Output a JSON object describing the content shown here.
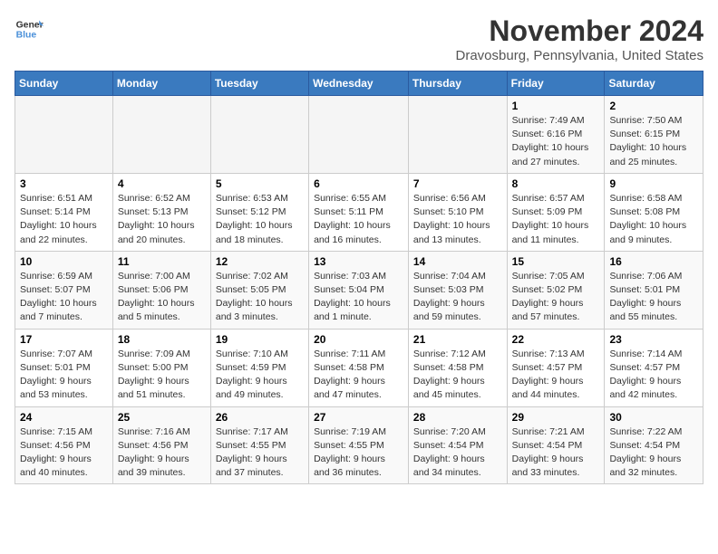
{
  "app": {
    "name_part1": "General",
    "name_part2": "Blue"
  },
  "header": {
    "month_year": "November 2024",
    "location": "Dravosburg, Pennsylvania, United States"
  },
  "weekdays": [
    "Sunday",
    "Monday",
    "Tuesday",
    "Wednesday",
    "Thursday",
    "Friday",
    "Saturday"
  ],
  "weeks": [
    [
      {
        "day": "",
        "info": ""
      },
      {
        "day": "",
        "info": ""
      },
      {
        "day": "",
        "info": ""
      },
      {
        "day": "",
        "info": ""
      },
      {
        "day": "",
        "info": ""
      },
      {
        "day": "1",
        "info": "Sunrise: 7:49 AM\nSunset: 6:16 PM\nDaylight: 10 hours and 27 minutes."
      },
      {
        "day": "2",
        "info": "Sunrise: 7:50 AM\nSunset: 6:15 PM\nDaylight: 10 hours and 25 minutes."
      }
    ],
    [
      {
        "day": "3",
        "info": "Sunrise: 6:51 AM\nSunset: 5:14 PM\nDaylight: 10 hours and 22 minutes."
      },
      {
        "day": "4",
        "info": "Sunrise: 6:52 AM\nSunset: 5:13 PM\nDaylight: 10 hours and 20 minutes."
      },
      {
        "day": "5",
        "info": "Sunrise: 6:53 AM\nSunset: 5:12 PM\nDaylight: 10 hours and 18 minutes."
      },
      {
        "day": "6",
        "info": "Sunrise: 6:55 AM\nSunset: 5:11 PM\nDaylight: 10 hours and 16 minutes."
      },
      {
        "day": "7",
        "info": "Sunrise: 6:56 AM\nSunset: 5:10 PM\nDaylight: 10 hours and 13 minutes."
      },
      {
        "day": "8",
        "info": "Sunrise: 6:57 AM\nSunset: 5:09 PM\nDaylight: 10 hours and 11 minutes."
      },
      {
        "day": "9",
        "info": "Sunrise: 6:58 AM\nSunset: 5:08 PM\nDaylight: 10 hours and 9 minutes."
      }
    ],
    [
      {
        "day": "10",
        "info": "Sunrise: 6:59 AM\nSunset: 5:07 PM\nDaylight: 10 hours and 7 minutes."
      },
      {
        "day": "11",
        "info": "Sunrise: 7:00 AM\nSunset: 5:06 PM\nDaylight: 10 hours and 5 minutes."
      },
      {
        "day": "12",
        "info": "Sunrise: 7:02 AM\nSunset: 5:05 PM\nDaylight: 10 hours and 3 minutes."
      },
      {
        "day": "13",
        "info": "Sunrise: 7:03 AM\nSunset: 5:04 PM\nDaylight: 10 hours and 1 minute."
      },
      {
        "day": "14",
        "info": "Sunrise: 7:04 AM\nSunset: 5:03 PM\nDaylight: 9 hours and 59 minutes."
      },
      {
        "day": "15",
        "info": "Sunrise: 7:05 AM\nSunset: 5:02 PM\nDaylight: 9 hours and 57 minutes."
      },
      {
        "day": "16",
        "info": "Sunrise: 7:06 AM\nSunset: 5:01 PM\nDaylight: 9 hours and 55 minutes."
      }
    ],
    [
      {
        "day": "17",
        "info": "Sunrise: 7:07 AM\nSunset: 5:01 PM\nDaylight: 9 hours and 53 minutes."
      },
      {
        "day": "18",
        "info": "Sunrise: 7:09 AM\nSunset: 5:00 PM\nDaylight: 9 hours and 51 minutes."
      },
      {
        "day": "19",
        "info": "Sunrise: 7:10 AM\nSunset: 4:59 PM\nDaylight: 9 hours and 49 minutes."
      },
      {
        "day": "20",
        "info": "Sunrise: 7:11 AM\nSunset: 4:58 PM\nDaylight: 9 hours and 47 minutes."
      },
      {
        "day": "21",
        "info": "Sunrise: 7:12 AM\nSunset: 4:58 PM\nDaylight: 9 hours and 45 minutes."
      },
      {
        "day": "22",
        "info": "Sunrise: 7:13 AM\nSunset: 4:57 PM\nDaylight: 9 hours and 44 minutes."
      },
      {
        "day": "23",
        "info": "Sunrise: 7:14 AM\nSunset: 4:57 PM\nDaylight: 9 hours and 42 minutes."
      }
    ],
    [
      {
        "day": "24",
        "info": "Sunrise: 7:15 AM\nSunset: 4:56 PM\nDaylight: 9 hours and 40 minutes."
      },
      {
        "day": "25",
        "info": "Sunrise: 7:16 AM\nSunset: 4:56 PM\nDaylight: 9 hours and 39 minutes."
      },
      {
        "day": "26",
        "info": "Sunrise: 7:17 AM\nSunset: 4:55 PM\nDaylight: 9 hours and 37 minutes."
      },
      {
        "day": "27",
        "info": "Sunrise: 7:19 AM\nSunset: 4:55 PM\nDaylight: 9 hours and 36 minutes."
      },
      {
        "day": "28",
        "info": "Sunrise: 7:20 AM\nSunset: 4:54 PM\nDaylight: 9 hours and 34 minutes."
      },
      {
        "day": "29",
        "info": "Sunrise: 7:21 AM\nSunset: 4:54 PM\nDaylight: 9 hours and 33 minutes."
      },
      {
        "day": "30",
        "info": "Sunrise: 7:22 AM\nSunset: 4:54 PM\nDaylight: 9 hours and 32 minutes."
      }
    ]
  ]
}
